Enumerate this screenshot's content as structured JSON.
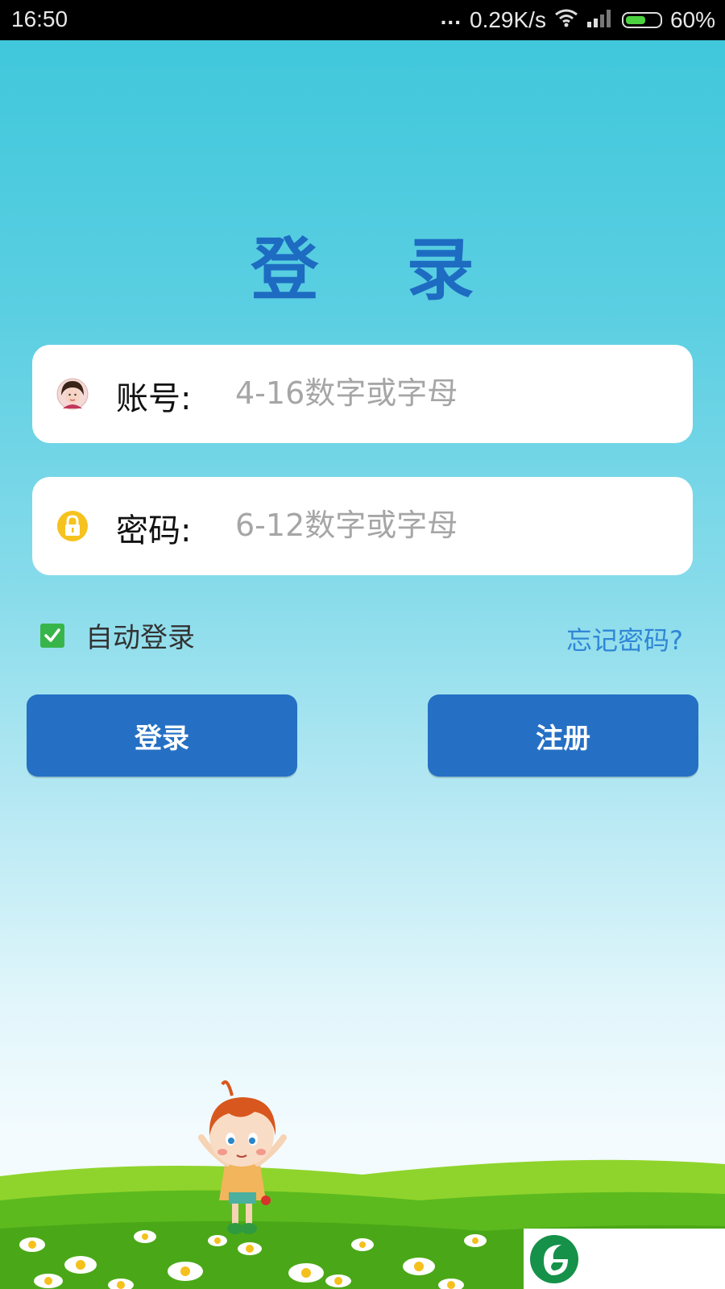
{
  "status_bar": {
    "time": "16:50",
    "dots": "...",
    "network_speed": "0.29K/s",
    "battery_percent": "60%",
    "battery_level": 0.6,
    "wifi_icon": "wifi-icon",
    "signal_icon": "signal-bars-icon"
  },
  "login": {
    "title": "登 录",
    "account": {
      "label": "账号:",
      "placeholder": "4-16数字或字母",
      "value": "",
      "icon": "user-avatar-icon"
    },
    "password": {
      "label": "密码:",
      "placeholder": "6-12数字或字母",
      "value": "",
      "icon": "lock-icon"
    },
    "auto_login": {
      "label": "自动登录",
      "checked": true
    },
    "forgot_password": "忘记密码?",
    "login_button": "登录",
    "register_button": "注册"
  },
  "colors": {
    "title": "#1e6bc2",
    "button": "#2570c4",
    "link": "#2f86d6",
    "checkbox": "#38b54a"
  },
  "decoration": {
    "illustration": "cartoon-girl-on-meadow",
    "logo": "green-g-logo-icon"
  }
}
